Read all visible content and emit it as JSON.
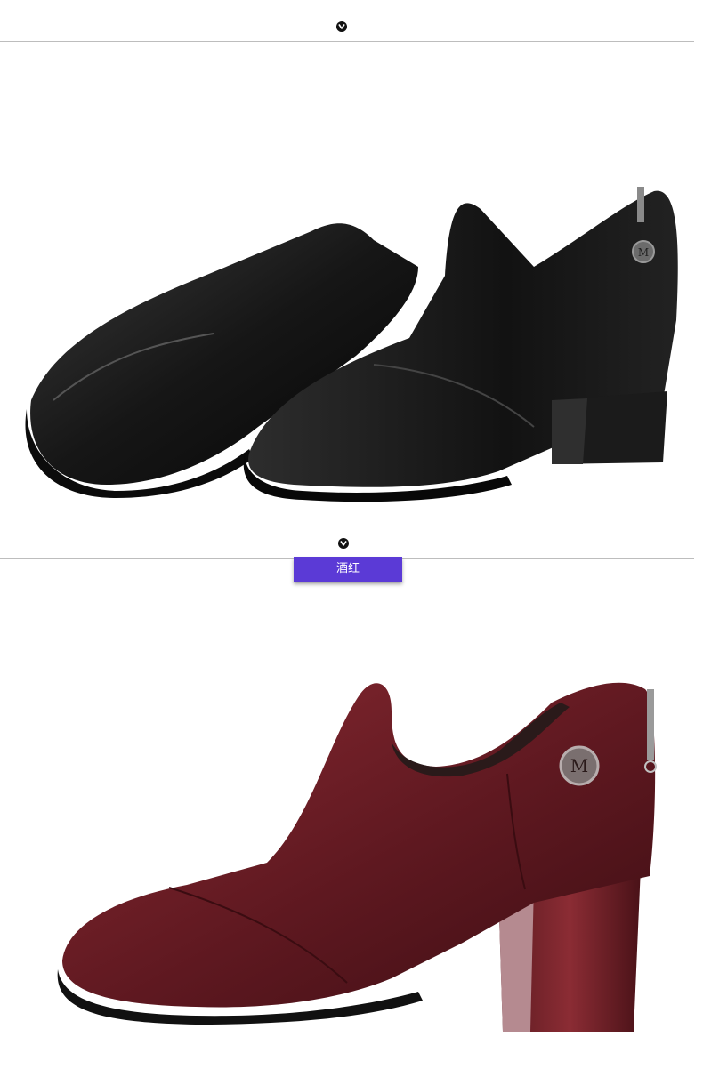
{
  "sections": [
    {
      "chevron_icon": "chevron-down-icon",
      "product_color": "black"
    },
    {
      "chevron_icon": "chevron-down-icon",
      "color_label": "酒红",
      "product_color": "wine red"
    }
  ],
  "colors": {
    "label_bg": "#5b3ad6",
    "divider": "#bdbdbd",
    "black_leather": "#1a1a1a",
    "wine_leather": "#6e1a22"
  }
}
